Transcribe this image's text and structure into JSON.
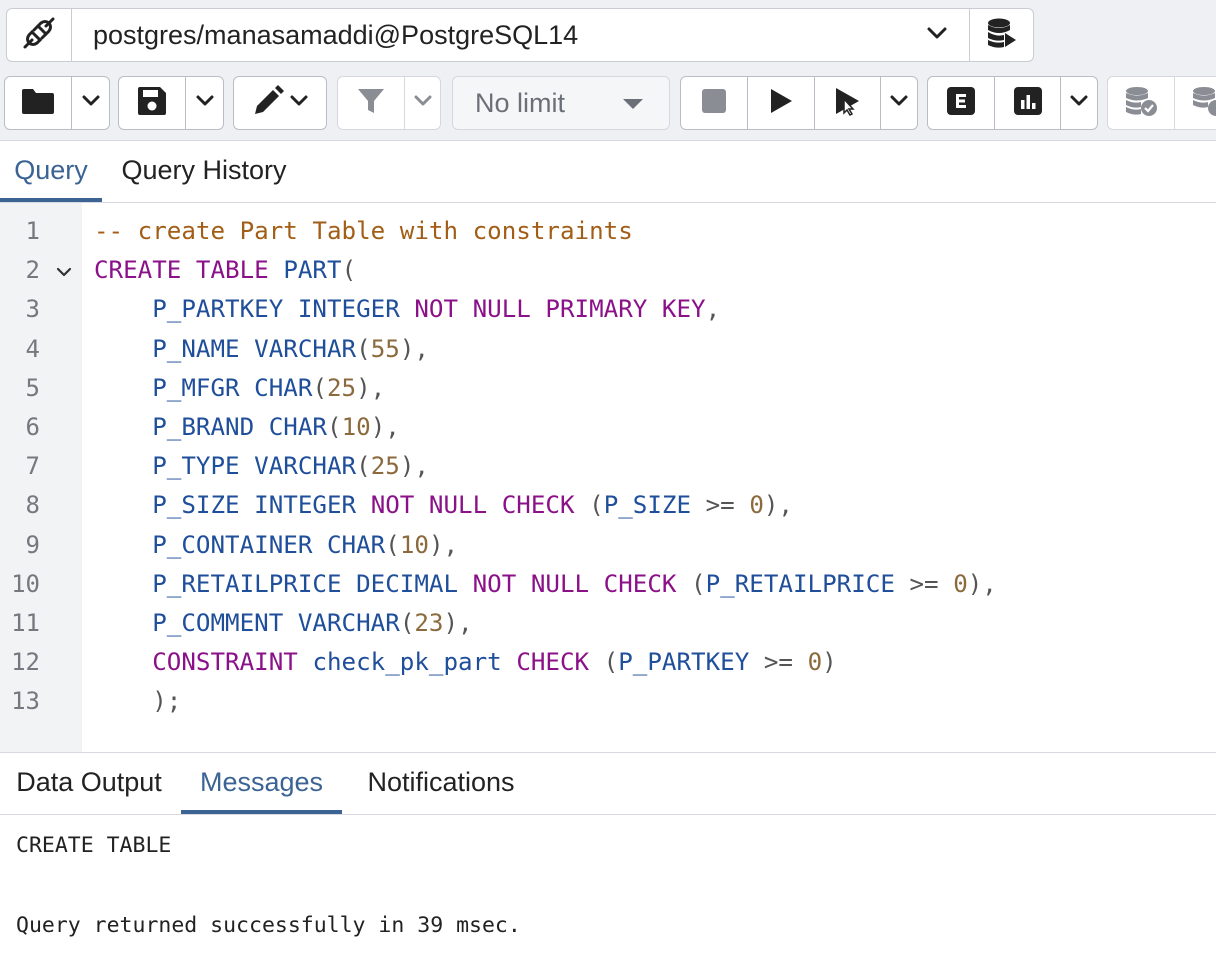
{
  "connection": {
    "label": "postgres/manasamaddi@PostgreSQL14"
  },
  "toolbar": {
    "limit_value": "No limit"
  },
  "query_tabs": [
    {
      "label": "Query",
      "active": true
    },
    {
      "label": "Query History",
      "active": false
    }
  ],
  "editor": {
    "line_numbers": [
      "1",
      "2",
      "3",
      "4",
      "5",
      "6",
      "7",
      "8",
      "9",
      "10",
      "11",
      "12",
      "13"
    ],
    "lines": [
      [
        {
          "t": "-- create Part Table with constraints",
          "c": "c"
        }
      ],
      [
        {
          "t": "CREATE TABLE",
          "c": "k"
        },
        {
          "t": " ",
          "c": "p"
        },
        {
          "t": "PART",
          "c": "i"
        },
        {
          "t": "(",
          "c": "p"
        }
      ],
      [
        {
          "t": "    P_PARTKEY INTEGER",
          "c": "i"
        },
        {
          "t": " ",
          "c": "p"
        },
        {
          "t": "NOT NULL PRIMARY KEY",
          "c": "k"
        },
        {
          "t": ",",
          "c": "p"
        }
      ],
      [
        {
          "t": "    P_NAME VARCHAR",
          "c": "i"
        },
        {
          "t": "(",
          "c": "p"
        },
        {
          "t": "55",
          "c": "n"
        },
        {
          "t": "),",
          "c": "p"
        }
      ],
      [
        {
          "t": "    P_MFGR CHAR",
          "c": "i"
        },
        {
          "t": "(",
          "c": "p"
        },
        {
          "t": "25",
          "c": "n"
        },
        {
          "t": "),",
          "c": "p"
        }
      ],
      [
        {
          "t": "    P_BRAND CHAR",
          "c": "i"
        },
        {
          "t": "(",
          "c": "p"
        },
        {
          "t": "10",
          "c": "n"
        },
        {
          "t": "),",
          "c": "p"
        }
      ],
      [
        {
          "t": "    P_TYPE VARCHAR",
          "c": "i"
        },
        {
          "t": "(",
          "c": "p"
        },
        {
          "t": "25",
          "c": "n"
        },
        {
          "t": "),",
          "c": "p"
        }
      ],
      [
        {
          "t": "    P_SIZE INTEGER",
          "c": "i"
        },
        {
          "t": " ",
          "c": "p"
        },
        {
          "t": "NOT NULL CHECK",
          "c": "k"
        },
        {
          "t": " (",
          "c": "p"
        },
        {
          "t": "P_SIZE",
          "c": "i"
        },
        {
          "t": " >= ",
          "c": "p"
        },
        {
          "t": "0",
          "c": "n"
        },
        {
          "t": "),",
          "c": "p"
        }
      ],
      [
        {
          "t": "    P_CONTAINER CHAR",
          "c": "i"
        },
        {
          "t": "(",
          "c": "p"
        },
        {
          "t": "10",
          "c": "n"
        },
        {
          "t": "),",
          "c": "p"
        }
      ],
      [
        {
          "t": "    P_RETAILPRICE DECIMAL",
          "c": "i"
        },
        {
          "t": " ",
          "c": "p"
        },
        {
          "t": "NOT NULL CHECK",
          "c": "k"
        },
        {
          "t": " (",
          "c": "p"
        },
        {
          "t": "P_RETAILPRICE",
          "c": "i"
        },
        {
          "t": " >= ",
          "c": "p"
        },
        {
          "t": "0",
          "c": "n"
        },
        {
          "t": "),",
          "c": "p"
        }
      ],
      [
        {
          "t": "    P_COMMENT VARCHAR",
          "c": "i"
        },
        {
          "t": "(",
          "c": "p"
        },
        {
          "t": "23",
          "c": "n"
        },
        {
          "t": "),",
          "c": "p"
        }
      ],
      [
        {
          "t": "    ",
          "c": "p"
        },
        {
          "t": "CONSTRAINT",
          "c": "k"
        },
        {
          "t": " ",
          "c": "p"
        },
        {
          "t": "check_pk_part",
          "c": "i"
        },
        {
          "t": " ",
          "c": "p"
        },
        {
          "t": "CHECK",
          "c": "k"
        },
        {
          "t": " (",
          "c": "p"
        },
        {
          "t": "P_PARTKEY",
          "c": "i"
        },
        {
          "t": " >= ",
          "c": "p"
        },
        {
          "t": "0",
          "c": "n"
        },
        {
          "t": ")",
          "c": "p"
        }
      ],
      [
        {
          "t": "    );",
          "c": "p"
        }
      ]
    ]
  },
  "result_tabs": [
    {
      "label": "Data Output",
      "active": false
    },
    {
      "label": "Messages",
      "active": true
    },
    {
      "label": "Notifications",
      "active": false
    }
  ],
  "messages": {
    "line1": "CREATE TABLE",
    "line2": "Query returned successfully in 39 msec."
  },
  "colors": {
    "accent": "#3b6394",
    "keyword": "#8b1189",
    "identifier": "#1f4e9a",
    "number": "#8b6a3d",
    "comment": "#a25e17"
  }
}
